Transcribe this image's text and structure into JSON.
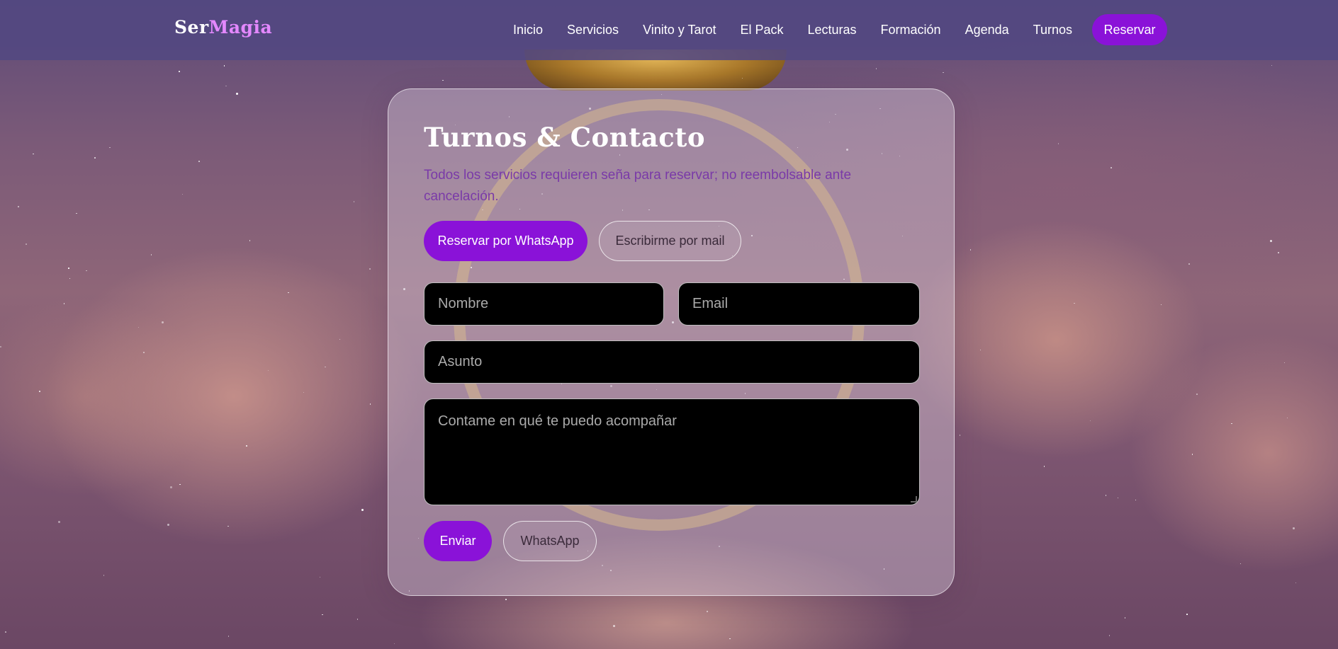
{
  "brand": {
    "part1": "Ser",
    "part2": "Magia"
  },
  "nav": {
    "items": [
      "Inicio",
      "Servicios",
      "Vinito y Tarot",
      "El Pack",
      "Lecturas",
      "Formación",
      "Agenda",
      "Turnos"
    ],
    "cta": "Reservar"
  },
  "contact": {
    "title": "Turnos & Contacto",
    "subtitle": "Todos los servicios requieren seña para reservar; no reembolsable ante cancelación.",
    "whatsapp_button": "Reservar por WhatsApp",
    "mail_button": "Escribirme por mail",
    "form": {
      "name_placeholder": "Nombre",
      "email_placeholder": "Email",
      "subject_placeholder": "Asunto",
      "message_placeholder": "Contame en qué te puedo acompañar",
      "send_button": "Enviar",
      "whatsapp_button": "WhatsApp"
    }
  },
  "colors": {
    "accent": "#8a12d8",
    "brand_highlight": "#e488ff",
    "subtitle": "#7a3aa8",
    "navbar": "#524882"
  }
}
